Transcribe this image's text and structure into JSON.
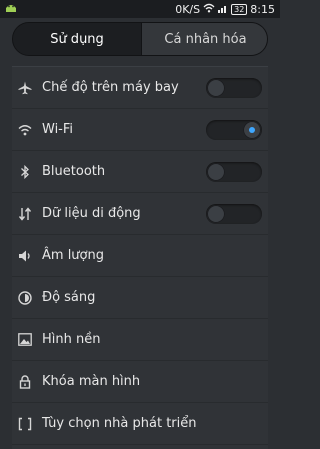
{
  "status_bar": {
    "network_speed": "0K/S",
    "battery": "32",
    "time": "8:15"
  },
  "tabs": {
    "active": "Sử dụng",
    "inactive": "Cá nhân hóa"
  },
  "settings": [
    {
      "label": "Chế độ trên máy bay",
      "icon": "airplane-icon",
      "toggle": "off"
    },
    {
      "label": "Wi-Fi",
      "icon": "wifi-icon",
      "toggle": "on"
    },
    {
      "label": "Bluetooth",
      "icon": "bluetooth-icon",
      "toggle": "off"
    },
    {
      "label": "Dữ liệu di động",
      "icon": "data-arrows-icon",
      "toggle": "off"
    },
    {
      "label": "Âm lượng",
      "icon": "volume-icon"
    },
    {
      "label": "Độ sáng",
      "icon": "brightness-icon"
    },
    {
      "label": "Hình nền",
      "icon": "image-icon"
    },
    {
      "label": "Khóa màn hình",
      "icon": "lock-icon"
    },
    {
      "label": "Tùy chọn nhà phát triển",
      "icon": "brackets-icon"
    }
  ],
  "colors": {
    "accent": "#3fa7ff"
  }
}
